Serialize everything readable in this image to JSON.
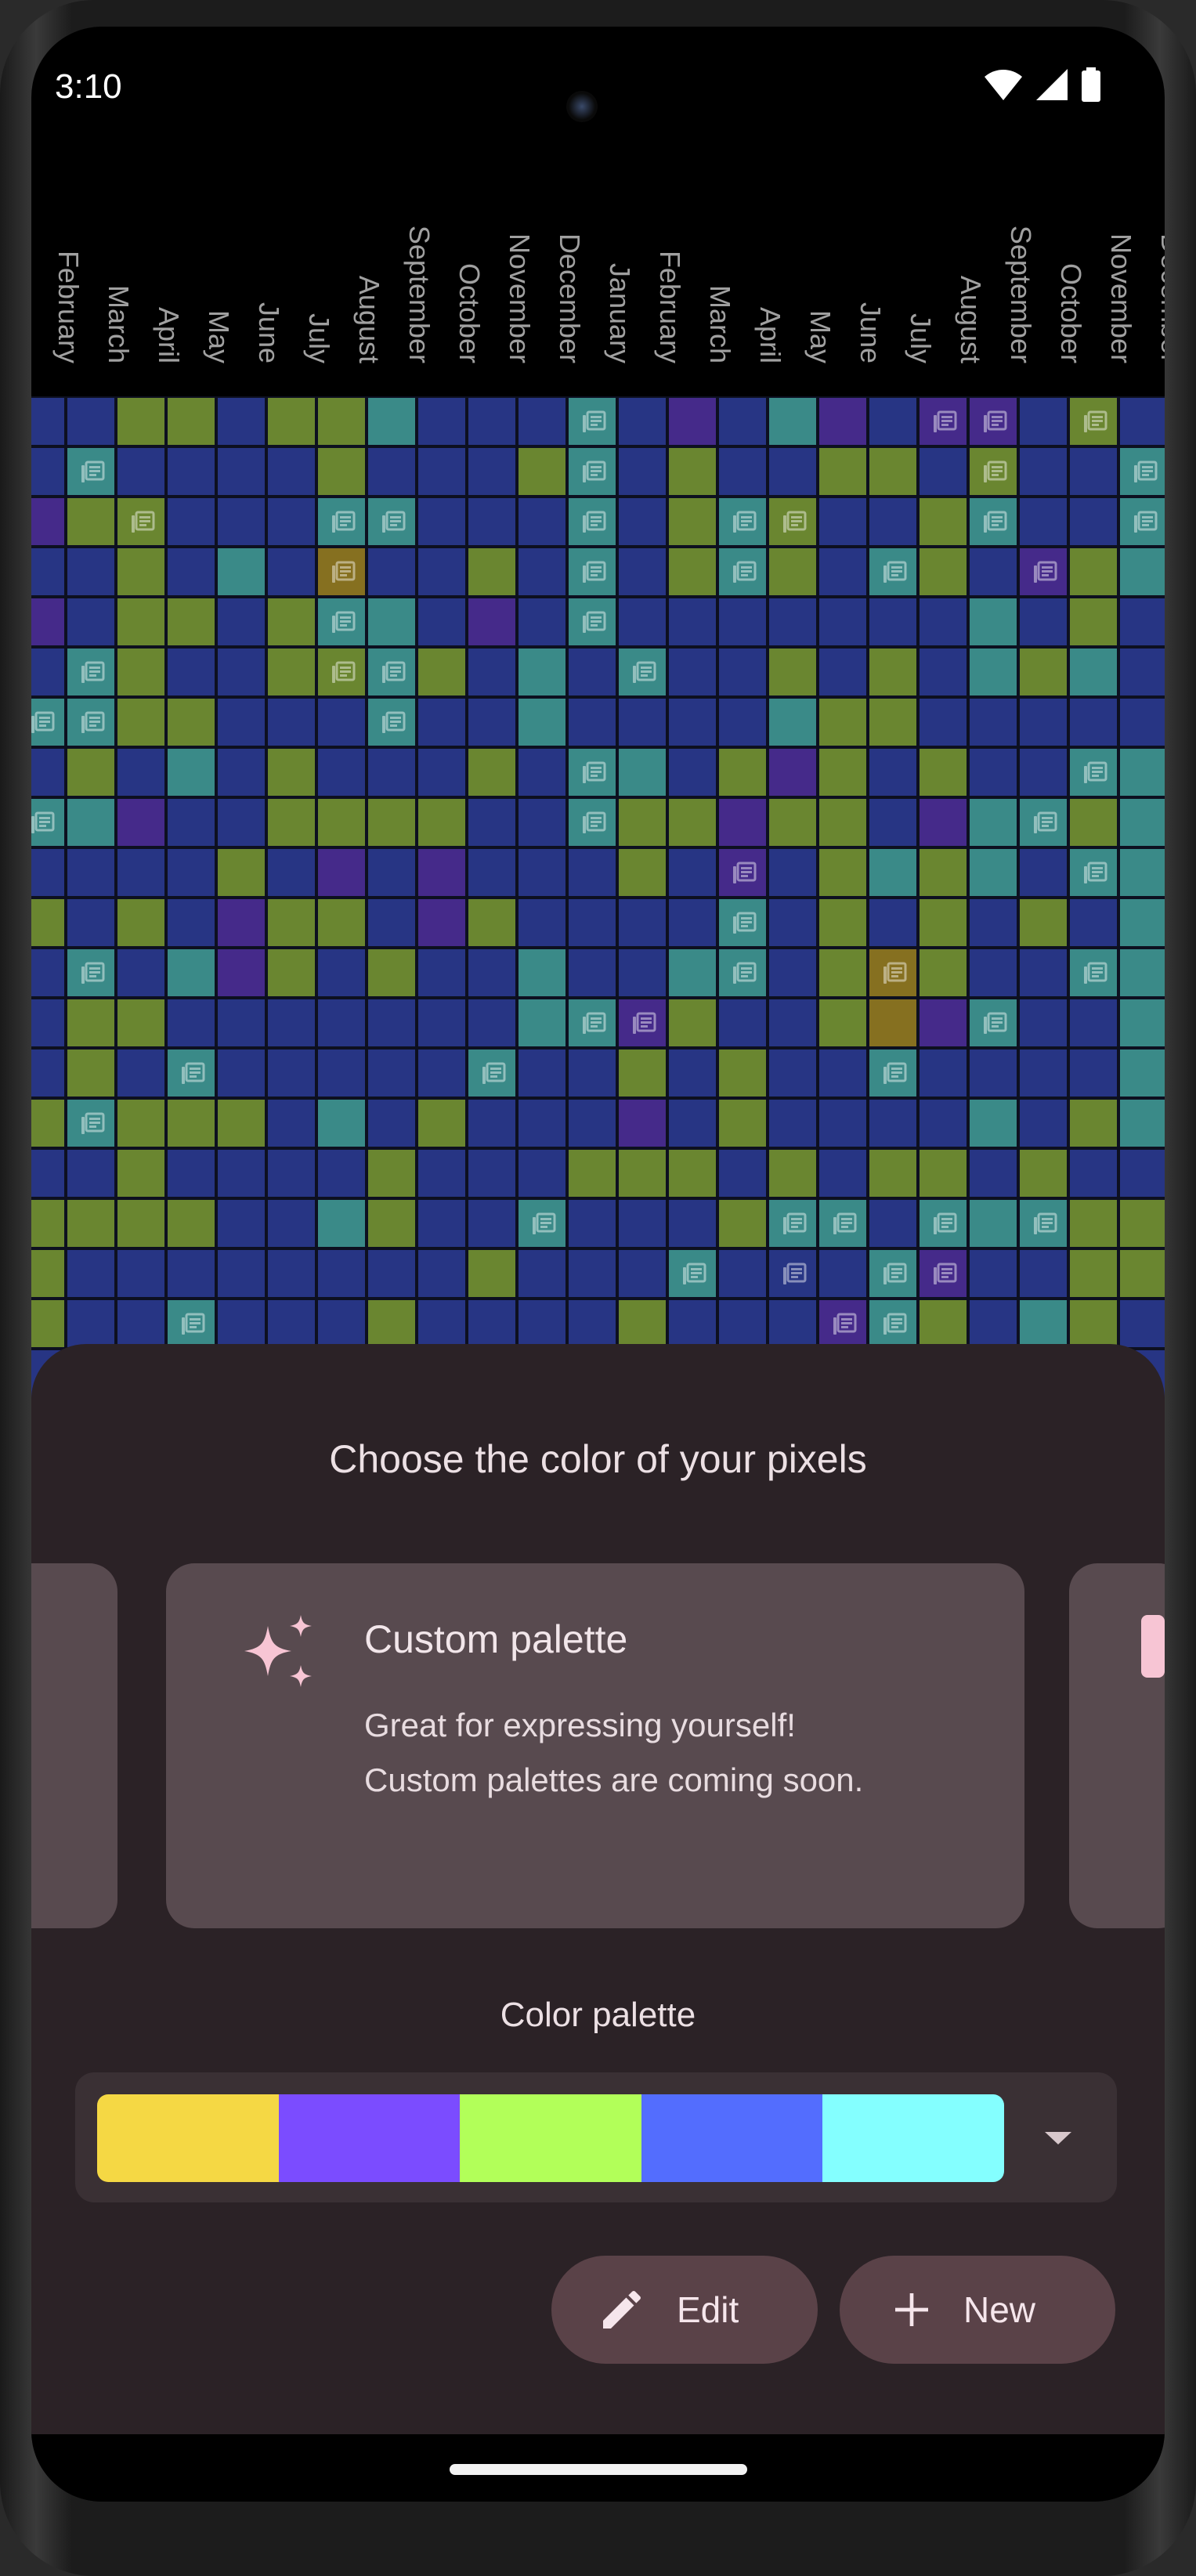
{
  "status_bar": {
    "time": "3:10",
    "icons": [
      "wifi-icon",
      "signal-icon",
      "battery-icon"
    ]
  },
  "month_headers": [
    "February",
    "March",
    "April",
    "May",
    "June",
    "July",
    "August",
    "September",
    "October",
    "November",
    "December",
    "January",
    "February",
    "March",
    "April",
    "May",
    "June",
    "July",
    "August",
    "September",
    "October",
    "November",
    "December"
  ],
  "pixel_colors": {
    "G": "#6a8630",
    "B": "#273584",
    "T": "#3a8a88",
    "P": "#452a8a",
    "O": "#867020",
    "grid_line": "#0d1020"
  },
  "pixel_grid": [
    "BBGGBGGTBBBTBPBTPBPPBGB",
    "BTBBBBGBBBGTBGBBGGBGBBT",
    "PGGBBBTTBBBTBGTGBBGTBBT",
    "BBGBTBOBBGBTBGTGBTGBPGT",
    "PBGGBGTTBPBTBBBBBBBTBGB",
    "BTGBBGGTGBTBTBBGBGBTGTB",
    "TTGGBBBTBBTBBBBTGGBBBBB",
    "BGBTBGBBBGBTTBGPGBGBBTT",
    "TTPBBGGGGBBTGGPGGBPTTGT",
    "BBBBGBPBPBBBGBPBGTGTBTT",
    "GBGBPGGBPGBBBBTBGBGBGBT",
    "BTBTPGBGBBTBBTTBGOGBBTT",
    "BGGBBBBBBBTTPGBBGOPTBBT",
    "BGBTBBBBBTBBGBGBBTBBBBT",
    "GTGGGBTBGBBBPBGBBBBTBGT",
    "BBGBBBBGBBBGGGBGBGGBGBB",
    "GGGGBBTGBBTBBBGTTBTTTGG",
    "GBBBBBBBBGBBBTBBBTPBBGG",
    "GBBTBBBGBBBBGBBBPTGBTGB",
    "BBTBBBBGBBBBGBBBBBBBBBB"
  ],
  "note_icons_positions": "cells marked by letter codes are drawn by script",
  "sheet": {
    "title": "Choose the color of your pixels",
    "card": {
      "icon": "sparkles-icon",
      "title": "Custom palette",
      "description": "Great for expressing yourself! Custom palettes are coming soon."
    },
    "palette_label": "Color palette",
    "palette_colors": [
      "#f5d844",
      "#7b4cff",
      "#b2ff59",
      "#536dfe",
      "#84ffff"
    ],
    "dropdown_icon": "arrow-drop-down-icon",
    "buttons": {
      "edit_label": "Edit",
      "edit_icon": "pencil-icon",
      "new_label": "New",
      "new_icon": "plus-icon"
    }
  }
}
